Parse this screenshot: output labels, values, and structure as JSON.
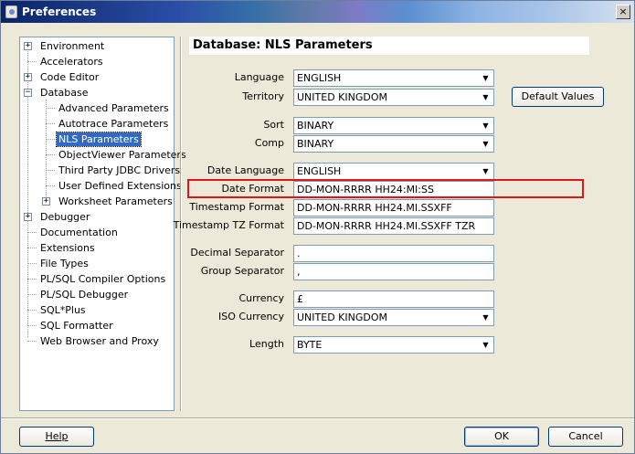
{
  "window": {
    "title": "Preferences",
    "close_glyph": "×"
  },
  "tree": {
    "items": [
      {
        "label": "Environment",
        "expander": "+"
      },
      {
        "label": "Accelerators"
      },
      {
        "label": "Code Editor",
        "expander": "+"
      },
      {
        "label": "Database",
        "expander": "−"
      },
      {
        "label": "Advanced Parameters"
      },
      {
        "label": "Autotrace Parameters"
      },
      {
        "label": "NLS Parameters",
        "selected": true
      },
      {
        "label": "ObjectViewer Parameters"
      },
      {
        "label": "Third Party JDBC Drivers"
      },
      {
        "label": "User Defined Extensions"
      },
      {
        "label": "Worksheet Parameters",
        "expander": "+"
      },
      {
        "label": "Debugger",
        "expander": "+"
      },
      {
        "label": "Documentation"
      },
      {
        "label": "Extensions"
      },
      {
        "label": "File Types"
      },
      {
        "label": "PL/SQL Compiler Options"
      },
      {
        "label": "PL/SQL Debugger"
      },
      {
        "label": "SQL*Plus"
      },
      {
        "label": "SQL Formatter"
      },
      {
        "label": "Web Browser and Proxy"
      }
    ]
  },
  "panel": {
    "title": "Database: NLS Parameters",
    "fields": {
      "language": {
        "label": "Language",
        "value": "ENGLISH"
      },
      "territory": {
        "label": "Territory",
        "value": "UNITED KINGDOM"
      },
      "sort": {
        "label": "Sort",
        "value": "BINARY"
      },
      "comp": {
        "label": "Comp",
        "value": "BINARY"
      },
      "date_language": {
        "label": "Date Language",
        "value": "ENGLISH"
      },
      "date_format": {
        "label": "Date Format",
        "value": "DD-MON-RRRR HH24:MI:SS"
      },
      "timestamp_format": {
        "label": "Timestamp Format",
        "value": "DD-MON-RRRR HH24.MI.SSXFF"
      },
      "timestamp_tz_format": {
        "label": "Timestamp TZ Format",
        "value": "DD-MON-RRRR HH24.MI.SSXFF TZR"
      },
      "decimal_separator": {
        "label": "Decimal Separator",
        "value": "."
      },
      "group_separator": {
        "label": "Group Separator",
        "value": ","
      },
      "currency": {
        "label": "Currency",
        "value": "£"
      },
      "iso_currency": {
        "label": "ISO Currency",
        "value": "UNITED KINGDOM"
      },
      "length": {
        "label": "Length",
        "value": "BYTE"
      }
    },
    "default_values_label": "Default Values"
  },
  "footer": {
    "help_label": "Help",
    "ok_label": "OK",
    "cancel_label": "Cancel"
  },
  "colors": {
    "highlight": "#e0141a",
    "selection": "#316ac5"
  },
  "icons": {
    "combo_arrow": "▼"
  }
}
